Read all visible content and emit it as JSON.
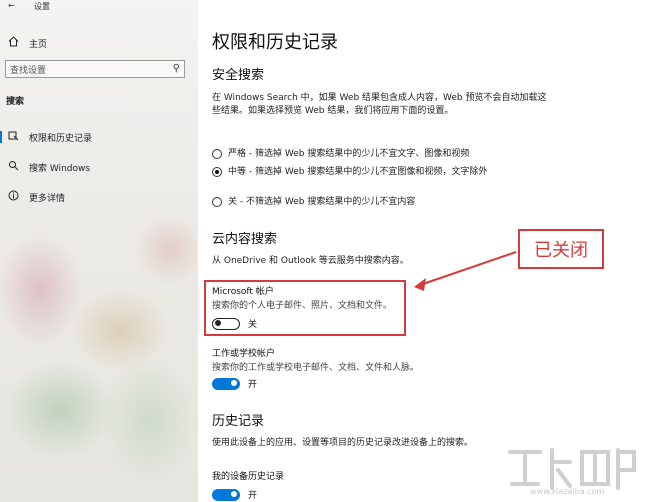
{
  "window": {
    "title": "设置"
  },
  "sidebar": {
    "home_label": "主页",
    "search_placeholder": "查找设置",
    "section_title": "搜索",
    "items": [
      {
        "label": "权限和历史记录",
        "icon": "permissions-icon",
        "active": true
      },
      {
        "label": "搜索 Windows",
        "icon": "search-icon",
        "active": false
      },
      {
        "label": "更多详情",
        "icon": "info-icon",
        "active": false
      }
    ]
  },
  "main": {
    "page_title": "权限和历史记录",
    "safe_search": {
      "heading": "安全搜索",
      "description": "在 Windows Search 中，如果 Web 结果包含成人内容，Web 预览不会自动加载这些结果。如果选择预览 Web 结果，我们将应用下面的设置。",
      "options": [
        {
          "label": "严格 - 筛选掉 Web 搜索结果中的少儿不宜文字、图像和视频",
          "selected": false
        },
        {
          "label": "中等 - 筛选掉 Web 搜索结果中的少儿不宜图像和视频，文字除外",
          "selected": true
        },
        {
          "label": "关 - 不筛选掉 Web 搜索结果中的少儿不宜内容",
          "selected": false
        }
      ]
    },
    "cloud_search": {
      "heading": "云内容搜索",
      "description": "从 OneDrive 和 Outlook 等云服务中搜索内容。",
      "ms_account": {
        "title": "Microsoft 帐户",
        "description": "搜索你的个人电子邮件、照片、文档和文件。",
        "toggle_state": "关",
        "on": false
      },
      "work_account": {
        "title": "工作或学校帐户",
        "description": "搜索你的工作或学校电子邮件、文档、文件和人脉。",
        "toggle_state": "开",
        "on": true
      }
    },
    "history": {
      "heading": "历史记录",
      "description": "使用此设备上的应用、设置等项目的历史记录改进设备上的搜索。",
      "device_history_title": "我的设备历史记录",
      "toggle_state": "开",
      "on": true
    }
  },
  "annotation": {
    "callout_text": "已关闭",
    "color": "#d63a3a"
  },
  "watermark": {
    "url": "www.xiazaiba.com"
  },
  "colors": {
    "accent": "#0078d7"
  }
}
